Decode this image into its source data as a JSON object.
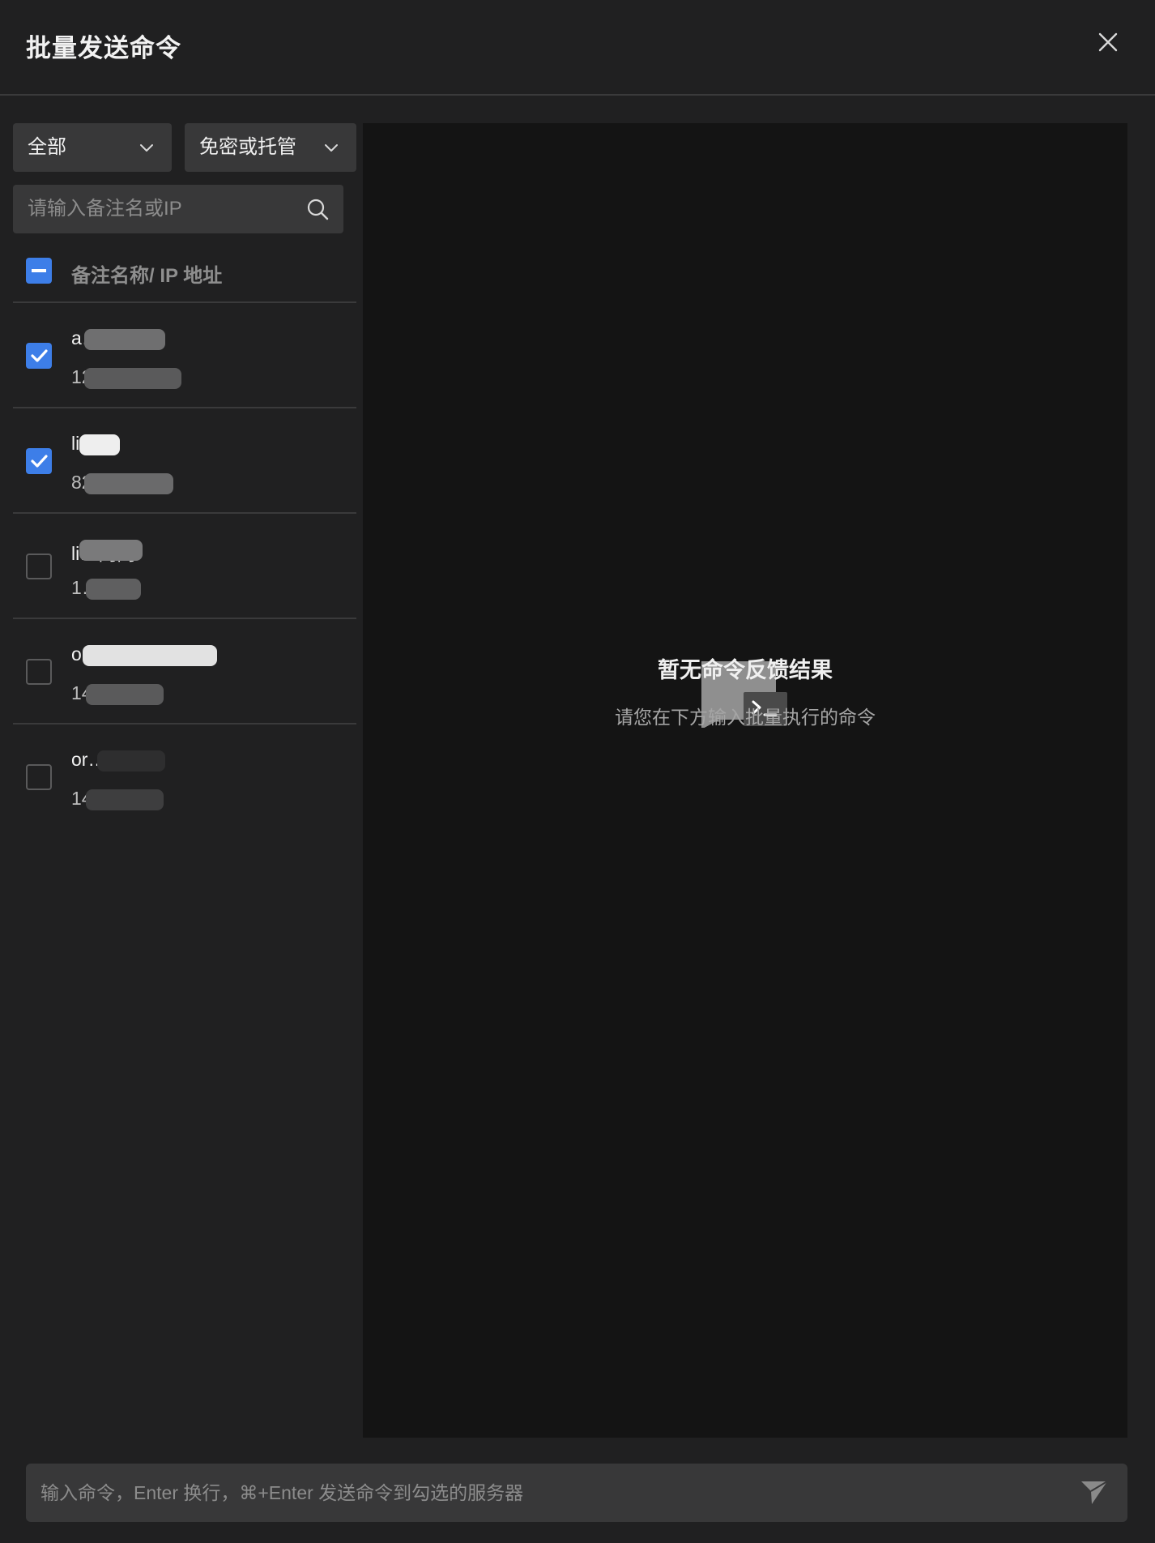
{
  "header": {
    "title": "批量发送命令"
  },
  "filters": {
    "group_value": "全部",
    "auth_value": "免密或托管",
    "search_placeholder": "请输入备注名或IP"
  },
  "list": {
    "header_label": "备注名称/ IP 地址",
    "select_all_state": "partial",
    "items": [
      {
        "name": "a…_bj",
        "ip": "12…30",
        "checked": true
      },
      {
        "name": "li…t",
        "ip": "82…6",
        "checked": true
      },
      {
        "name": "li…内网",
        "ip": "1…2",
        "checked": false
      },
      {
        "name": "o…h",
        "ip": "14….11",
        "checked": false
      },
      {
        "name": "or…st",
        "ip": "14….11",
        "checked": false
      }
    ]
  },
  "result": {
    "empty_title": "暂无命令反馈结果",
    "empty_subtitle": "请您在下方输入批量执行的命令"
  },
  "command": {
    "placeholder": "输入命令，Enter 换行，⌘+Enter 发送命令到勾选的服务器"
  },
  "colors": {
    "accent": "#3d7ee8",
    "background": "#202021",
    "panel": "#141414",
    "control": "#383839"
  }
}
